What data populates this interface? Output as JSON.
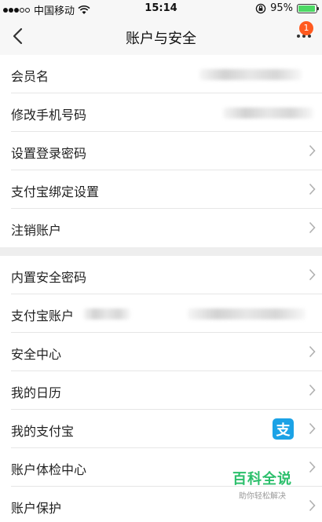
{
  "status_bar": {
    "carrier": "中国移动",
    "time": "15:14",
    "battery_text": "95%",
    "battery_level": 0.95,
    "icons": [
      "signal-dots-icon",
      "wifi-icon",
      "orientation-lock-icon",
      "battery-icon"
    ]
  },
  "nav": {
    "title": "账户与安全",
    "badge_count": "1",
    "icons": [
      "back-chevron-icon",
      "more-dots-icon"
    ]
  },
  "section1": {
    "items": [
      {
        "label": "会员名"
      },
      {
        "label": "修改手机号码"
      },
      {
        "label": "设置登录密码"
      },
      {
        "label": "支付宝绑定设置"
      },
      {
        "label": "注销账户"
      }
    ]
  },
  "section2": {
    "items": [
      {
        "label": "内置安全密码"
      },
      {
        "label": "支付宝账户"
      },
      {
        "label": "安全中心"
      },
      {
        "label": "我的日历"
      },
      {
        "label": "我的支付宝",
        "icon": "alipay-icon",
        "icon_glyph": "支"
      },
      {
        "label": "账户体检中心"
      },
      {
        "label": "账户保护"
      }
    ]
  },
  "watermark": {
    "title": "百科全说",
    "subtitle": "助你轻松解决"
  },
  "colors": {
    "accent_badge": "#ff5a1f",
    "alipay_blue": "#1ba2e6",
    "watermark_green": "#2bbf6b",
    "battery_green": "#4cd964"
  }
}
